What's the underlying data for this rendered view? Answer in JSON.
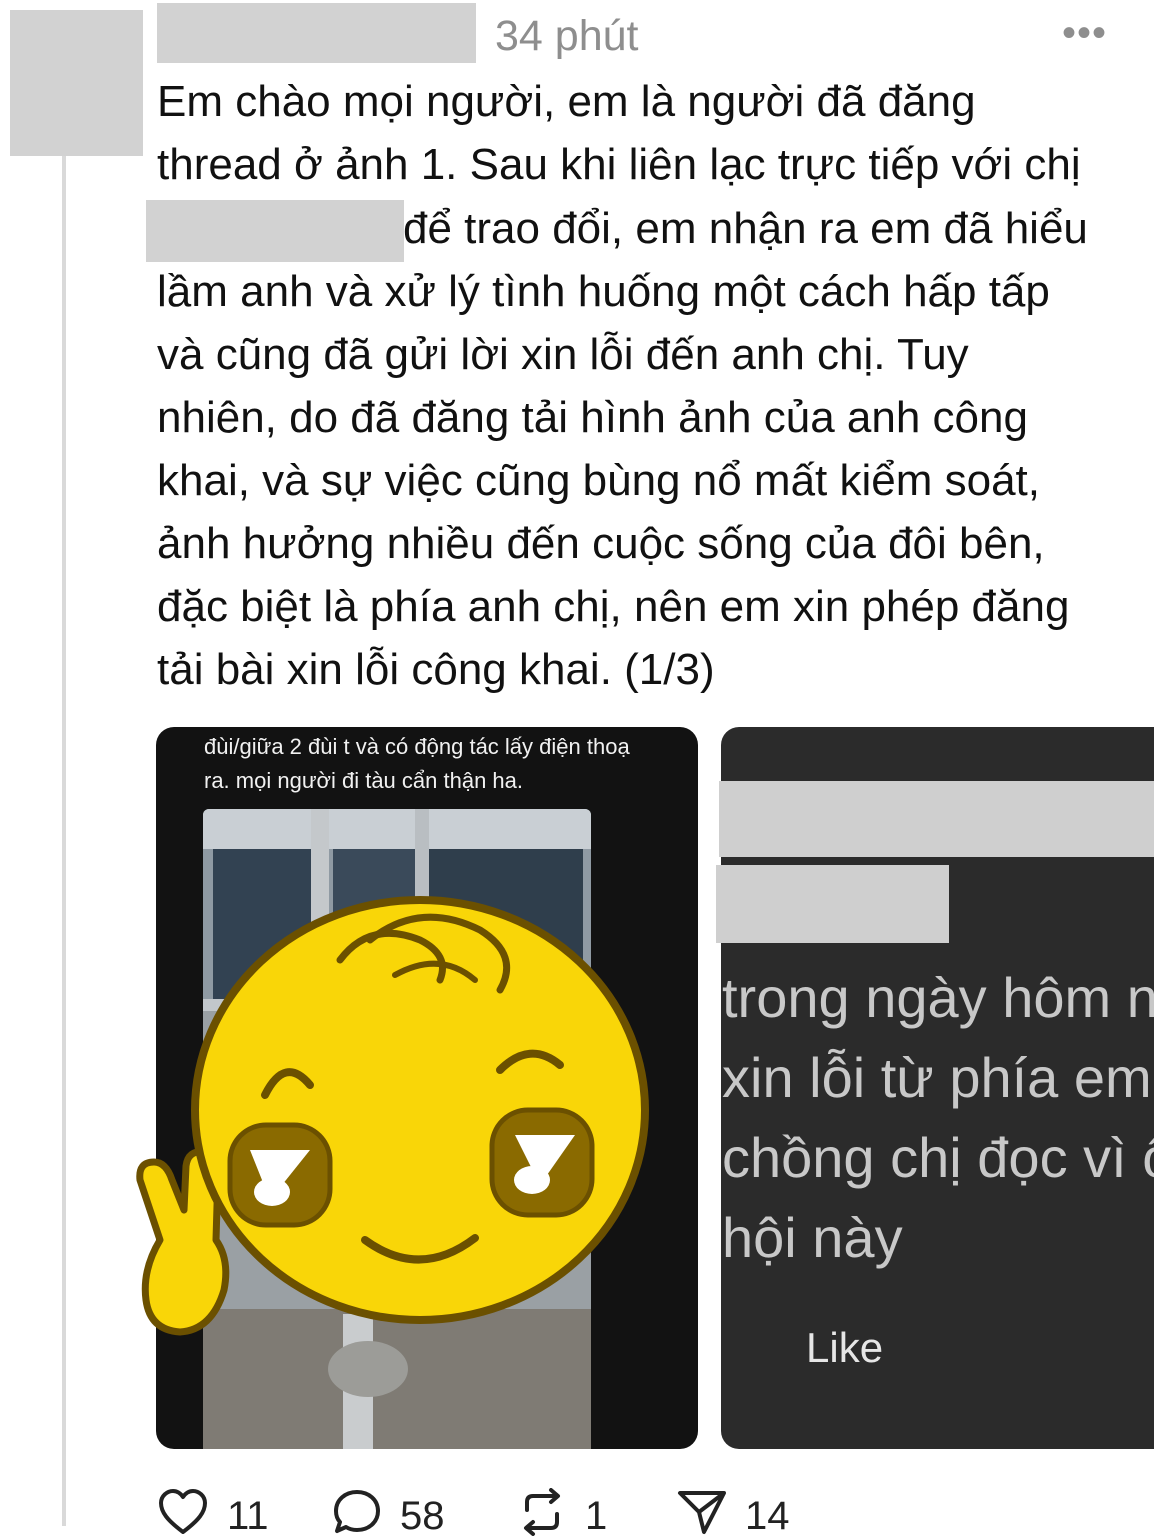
{
  "header": {
    "timestamp": "34 phút",
    "more_label": "•••"
  },
  "post": {
    "lines": [
      "Em chào mọi người, em là người đã đăng",
      "thread ở ảnh 1. Sau khi liên lạc trực tiếp với chị",
      "để trao đổi, em nhận ra em đã hiểu",
      "lầm anh và xử lý tình huống một cách hấp tấp",
      "và cũng đã gửi lời xin lỗi đến anh chị. Tuy",
      "nhiên, do đã đăng tải hình ảnh của anh công",
      "khai, và sự việc cũng bùng nổ mất kiểm soát,",
      "ảnh hưởng nhiều đến cuộc sống của đôi bên,",
      "đặc biệt là phía anh chị, nên em xin phép đăng",
      "tải bài xin lỗi công khai. (1/3)"
    ]
  },
  "media_1": {
    "caption_1": "đùi/giữa 2 đùi t và có động tác lấy điện thoạ",
    "caption_2": "ra. mọi người đi tàu cẩn thận ha."
  },
  "media_2": {
    "lines": [
      "trong ngày hôm n",
      "xin lỗi từ phía em",
      "chồng chị đọc vì ô",
      "hội này"
    ],
    "like_label": "Like"
  },
  "actions": {
    "likes": "11",
    "comments": "58",
    "reposts": "1",
    "shares": "14"
  },
  "colors": {
    "emoji_yellow": "#f9d608",
    "emoji_outline": "#6b5000",
    "redaction": "#d2d2d2"
  }
}
